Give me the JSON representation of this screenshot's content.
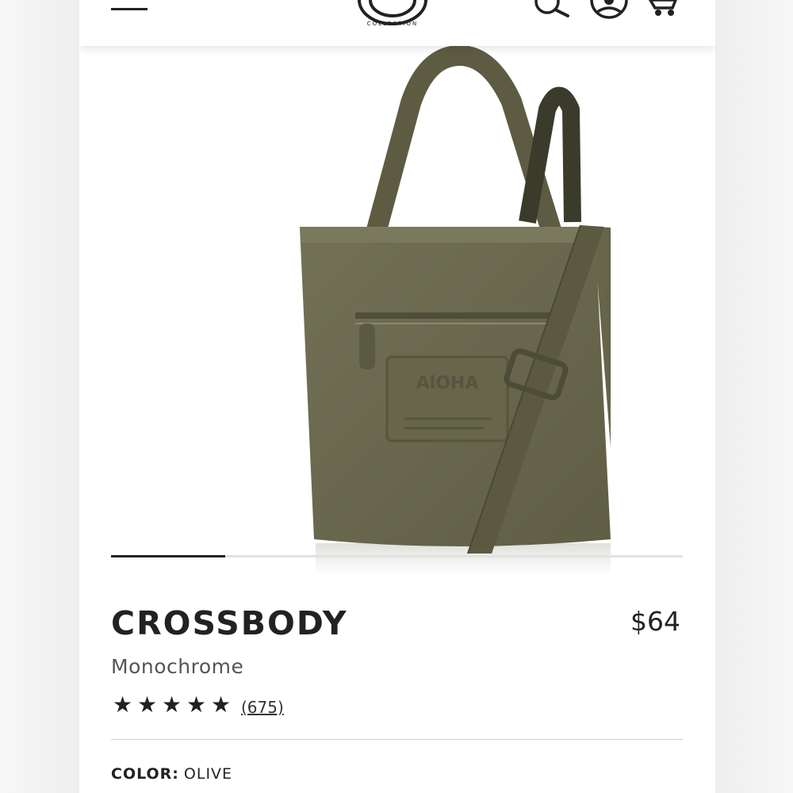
{
  "header": {
    "logo_text": "COLLECTION",
    "icons": [
      "menu-icon",
      "logo",
      "search-icon",
      "account-icon",
      "cart-icon"
    ]
  },
  "gallery": {
    "image_description_icon": "olive-tote-bag-image",
    "slide_progress": 0.2
  },
  "product": {
    "title": "CROSSBODY",
    "price": "$64",
    "subtitle": "Monochrome",
    "rating": 5,
    "stars": [
      "★",
      "★",
      "★",
      "★",
      "★"
    ],
    "review_count": "(675)",
    "color_label": "COLOR:",
    "color_value": "OLIVE"
  },
  "colors": {
    "text": "#222222",
    "bag_olive": "#6b6a4f"
  }
}
